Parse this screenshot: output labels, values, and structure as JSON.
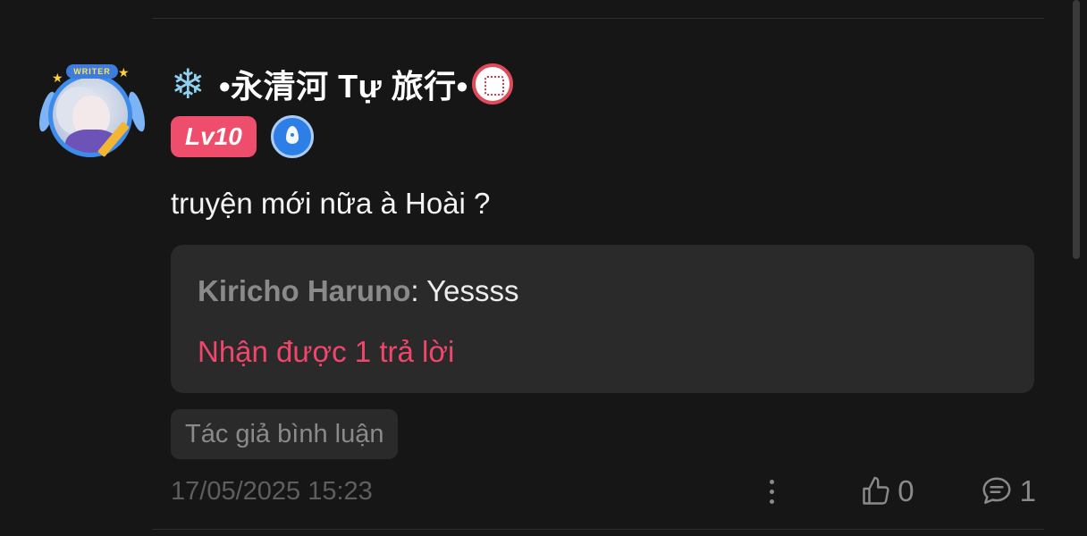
{
  "comment": {
    "avatar": {
      "badge_text": "WRITER",
      "icon": "writer-avatar"
    },
    "username": {
      "prefix_icon": "snowflake-icon",
      "text": "•永清河 Tự 旅行•",
      "suffix_icon": "seal-icon"
    },
    "level_badge": "Lv10",
    "writer_badge_icon": "fountain-pen-icon",
    "text": "truyện mới nữa à Hoài ?",
    "reply_preview": {
      "author": "Kiricho Haruno",
      "separator": ": ",
      "text": "Yessss",
      "reply_count_text": "Nhận được 1 trả lời"
    },
    "author_tag": "Tác giả bình luận",
    "timestamp": "17/05/2025 15:23",
    "likes": "0",
    "replies": "1"
  },
  "colors": {
    "background": "#161616",
    "accent_pink": "#f0466b",
    "level_badge": "#ee4d6b",
    "reply_box": "#2a2a2a",
    "muted_text": "#8a8a8a"
  }
}
